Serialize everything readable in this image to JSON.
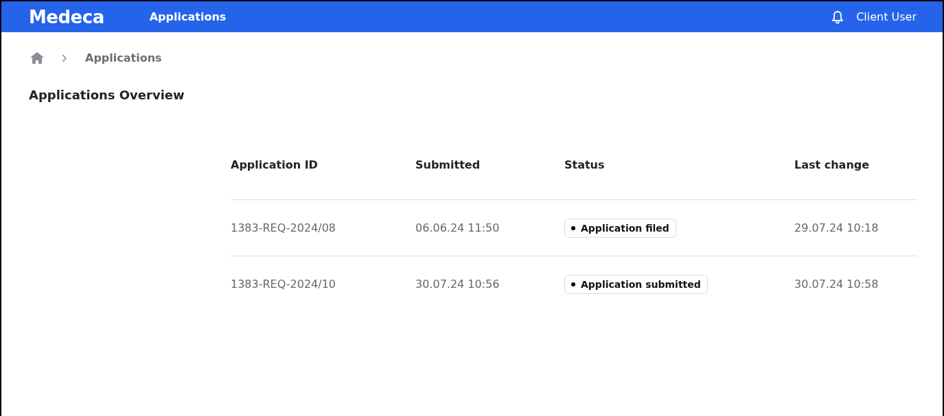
{
  "header": {
    "logo": "Medeca",
    "nav": "Applications",
    "user": "Client User"
  },
  "breadcrumb": {
    "current": "Applications"
  },
  "page_title": "Applications Overview",
  "table": {
    "columns": [
      "Application ID",
      "Submitted",
      "Status",
      "Last change"
    ],
    "rows": [
      {
        "id": "1383-REQ-2024/08",
        "submitted": "06.06.24 11:50",
        "status": "Application filed",
        "last_change": "29.07.24 10:18"
      },
      {
        "id": "1383-REQ-2024/10",
        "submitted": "30.07.24 10:56",
        "status": "Application submitted",
        "last_change": "30.07.24 10:58"
      }
    ]
  }
}
